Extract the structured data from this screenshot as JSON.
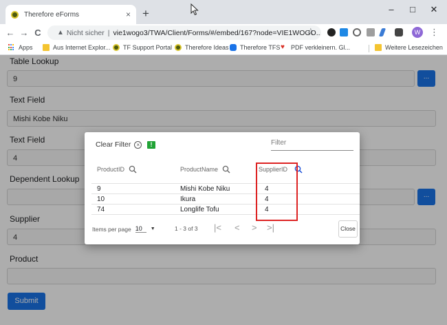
{
  "browser": {
    "tab_title": "Therefore eForms",
    "tab_close": "×",
    "new_tab": "+",
    "nav": {
      "back": "←",
      "forward": "→",
      "reload": "C"
    },
    "address": {
      "security_label": "Nicht sicher",
      "separator": "|",
      "url": "vie1wogo3/TWA/Client/Forms/#/embed/167?node=VIE1WOGO..."
    },
    "star": "☆",
    "avatar_letter": "W",
    "menu": "⋮",
    "window_controls": {
      "minimize": "–",
      "maximize": "□",
      "close": "✕"
    }
  },
  "bookmarks": [
    "Apps",
    "Aus Internet Explor...",
    "TF Support Portal",
    "Therefore Ideas",
    "Therefore TFS",
    "PDF verkleinern. Gl...",
    "Weitere Lesezeichen"
  ],
  "form": {
    "fields": [
      {
        "label": "Table Lookup",
        "value": "9"
      },
      {
        "label": "Text Field",
        "value": "Mishi Kobe Niku"
      },
      {
        "label": "Text Field",
        "value": "4"
      },
      {
        "label": "Dependent Lookup",
        "value": ""
      },
      {
        "label": "Supplier",
        "value": "4"
      },
      {
        "label": "Product",
        "value": ""
      }
    ],
    "lookup_button": "...",
    "submit": "Submit"
  },
  "modal": {
    "clear_filter": "Clear Filter",
    "clear_icon": "×",
    "export_icon": "!",
    "filter_placeholder": "Filter",
    "columns": [
      "ProductID",
      "ProductName",
      "SupplierID"
    ],
    "rows": [
      [
        "9",
        "Mishi Kobe Niku",
        "4"
      ],
      [
        "10",
        "Ikura",
        "4"
      ],
      [
        "74",
        "Longlife Tofu",
        "4"
      ]
    ],
    "pager": {
      "items_label": "Items per page",
      "items_value": "10",
      "range": "1 - 3 of 3",
      "first": "|<",
      "prev": "<",
      "next": ">",
      "last": ">|"
    },
    "close": "Close"
  },
  "colors": {
    "primary": "#1a73e8",
    "highlight": "#dd2222",
    "export_green": "#21a336"
  }
}
